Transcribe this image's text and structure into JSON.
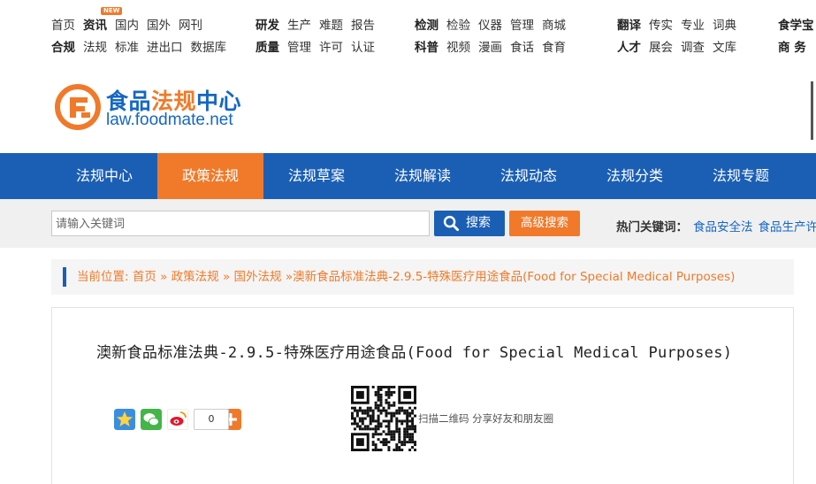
{
  "top_links": {
    "g1": {
      "row1": [
        "首页",
        "资讯",
        "国内",
        "国外",
        "网刊"
      ],
      "row2": [
        "合规",
        "法规",
        "标准",
        "进出口",
        "数据库"
      ],
      "badge": "NEW"
    },
    "g2": {
      "row1": [
        "研发",
        "生产",
        "难题",
        "报告"
      ],
      "row2": [
        "质量",
        "管理",
        "许可",
        "认证"
      ]
    },
    "g3": {
      "row1": [
        "检测",
        "检验",
        "仪器",
        "管理",
        "商城"
      ],
      "row2": [
        "科普",
        "视频",
        "漫画",
        "食话",
        "食育"
      ]
    },
    "g4": {
      "row1": [
        "翻译",
        "传实",
        "专业",
        "词典"
      ],
      "row2": [
        "人才",
        "展会",
        "调查",
        "文库"
      ]
    },
    "g5": {
      "row1": [
        "食学宝"
      ],
      "row2": [
        "商 务"
      ]
    }
  },
  "logo": {
    "cn_part1": "食品",
    "cn_part2": "法规",
    "cn_part3": "中心",
    "url": "law.foodmate.net"
  },
  "nav": {
    "items": [
      "法规中心",
      "政策法规",
      "法规草案",
      "法规解读",
      "法规动态",
      "法规分类",
      "法规专题"
    ],
    "active_index": 1
  },
  "search": {
    "placeholder": "请输入关键词",
    "button": "搜索",
    "advanced": "高级搜索",
    "hot_label": "热门关键词：",
    "hot_keywords": [
      "食品安全法",
      "食品生产许"
    ]
  },
  "breadcrumb": "当前位置: 首页 » 政策法规 » 国外法规 »澳新食品标准法典-2.9.5-特殊医疗用途食品(Food for Special Medical Purposes)",
  "article": {
    "title": "澳新食品标准法典-2.9.5-特殊医疗用途食品(Food for Special Medical Purposes)",
    "share_count": "0",
    "qr_caption": "扫描二维码 分享好友和朋友圈"
  },
  "colors": {
    "brand_blue": "#1b5fb4",
    "brand_orange": "#f07a2a"
  }
}
